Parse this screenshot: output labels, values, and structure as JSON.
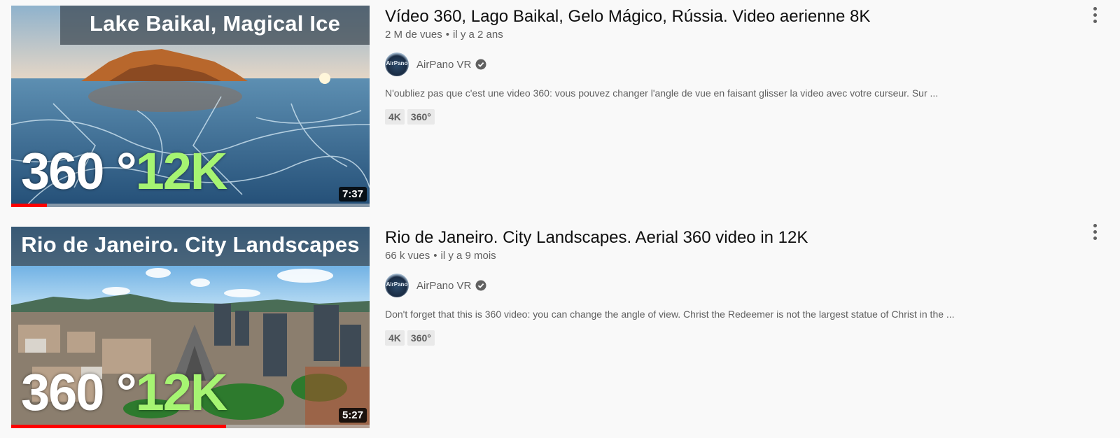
{
  "colors": {
    "progress": "#ff0000",
    "accent_12k": "#a6f472",
    "meta_text": "#606060"
  },
  "videos": [
    {
      "thumbnail": {
        "banner": "Lake Baikal, Magical Ice",
        "label_360": "360 °",
        "label_12k": "12K",
        "duration": "7:37",
        "watched_fraction": 0.1
      },
      "title": "Vídeo 360, Lago Baikal, Gelo Mágico, Rússia. Video aerienne 8K",
      "views": "2 M de vues",
      "age": "il y a 2 ans",
      "channel": "AirPano VR",
      "avatar_text": "AirPano",
      "description": "N'oubliez pas que c'est une video 360: vous pouvez changer l'angle de vue en faisant glisser la video avec votre curseur. Sur ...",
      "badges": [
        "4K",
        "360°"
      ],
      "more_icon": "three-dots-vertical-icon"
    },
    {
      "thumbnail": {
        "banner": "Rio de Janeiro. City Landscapes",
        "label_360": "360 °",
        "label_12k": "12K",
        "duration": "5:27",
        "watched_fraction": 0.6
      },
      "title": "Rio de Janeiro. City Landscapes. Aerial 360 video in 12K",
      "views": "66 k vues",
      "age": "il y a 9 mois",
      "channel": "AirPano VR",
      "avatar_text": "AirPano",
      "description": "Don't forget that this is 360 video: you can change the angle of view. Christ the Redeemer is not the largest statue of Christ in the ...",
      "badges": [
        "4K",
        "360°"
      ],
      "more_icon": "three-dots-vertical-icon"
    }
  ]
}
